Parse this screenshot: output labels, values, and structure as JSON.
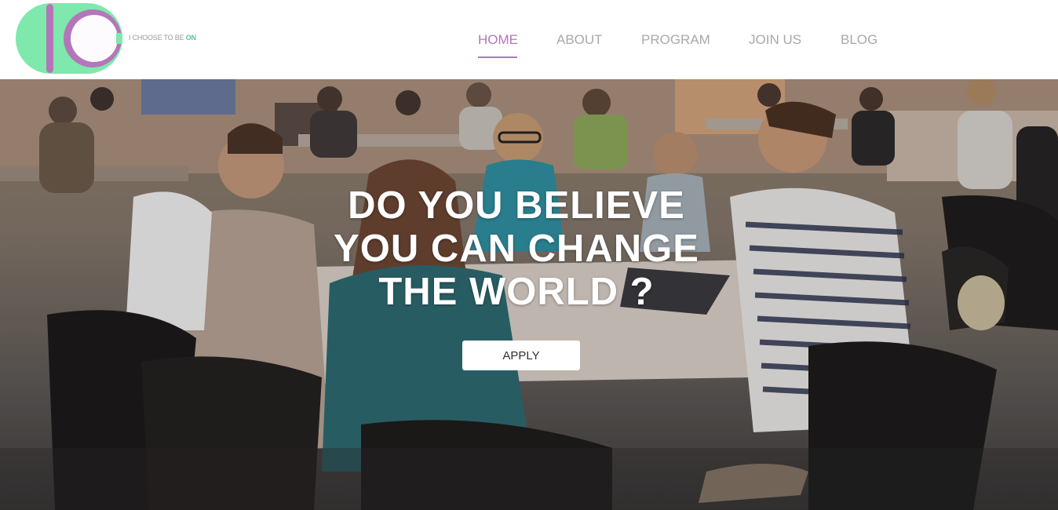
{
  "brand": {
    "logo_text": "IC",
    "tagline_prefix": "I CHOOSE TO BE",
    "tagline_highlight": "ON",
    "colors": {
      "green": "#7ee8ad",
      "purple": "#b476b9",
      "accent_on": "#5fc48e"
    }
  },
  "nav": {
    "items": [
      {
        "label": "HOME",
        "active": true
      },
      {
        "label": "ABOUT",
        "active": false
      },
      {
        "label": "PROGRAM",
        "active": false
      },
      {
        "label": "JOIN US",
        "active": false
      },
      {
        "label": "BLOG",
        "active": false
      }
    ],
    "active_color": "#b476b9",
    "inactive_color": "#a9a9a9"
  },
  "hero": {
    "title_lines": [
      "DO YOU BELIEVE",
      "YOU CAN CHANGE",
      "THE WORLD ?"
    ],
    "cta_label": "APPLY",
    "background": "photo-students-at-tables"
  }
}
